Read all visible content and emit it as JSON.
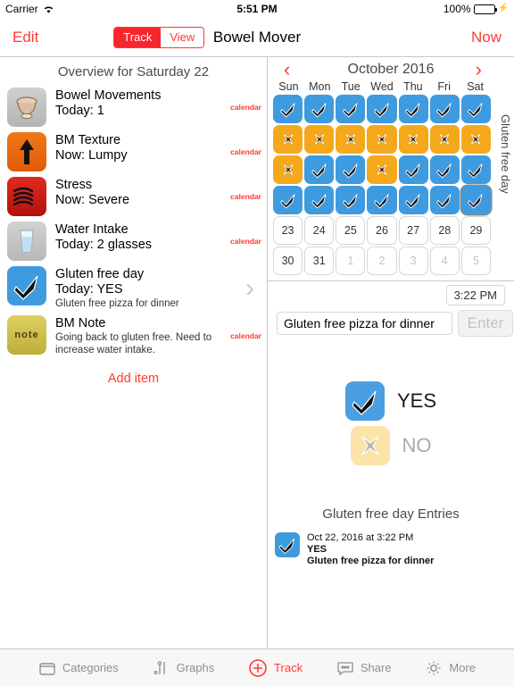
{
  "status_bar": {
    "carrier": "Carrier",
    "wifi_icon": "wifi-icon",
    "time": "5:51 PM",
    "battery_percent": "100%",
    "battery_icon": "battery-full-icon",
    "charging_icon": "lightning-bolt-icon"
  },
  "navbar": {
    "edit_label": "Edit",
    "segmented": {
      "track_label": "Track",
      "view_label": "View",
      "selected": "Track"
    },
    "title": "Bowel Mover",
    "now_label": "Now"
  },
  "left_panel": {
    "overview_title": "Overview for Saturday 22",
    "calendar_link_label": "calendar",
    "add_item_label": "Add item",
    "items": [
      {
        "icon": "toilet-icon",
        "title": "Bowel Movements",
        "subtitle": "Today: 1",
        "note": "",
        "accessory": "calendar"
      },
      {
        "icon": "up-arrow-icon",
        "title": "BM Texture",
        "subtitle": "Now: Lumpy",
        "note": "",
        "accessory": "calendar"
      },
      {
        "icon": "stress-waves-icon",
        "title": "Stress",
        "subtitle": "Now: Severe",
        "note": "",
        "accessory": "calendar"
      },
      {
        "icon": "water-glass-icon",
        "title": "Water Intake",
        "subtitle": "Today: 2 glasses",
        "note": "",
        "accessory": "calendar"
      },
      {
        "icon": "checkmark-icon",
        "title": "Gluten free day",
        "subtitle": "Today: YES",
        "note": "Gluten free pizza for dinner",
        "accessory": "chevron"
      },
      {
        "icon": "note-icon",
        "title": "BM Note",
        "subtitle": "",
        "note": "Going back to gluten free. Need to increase water intake.",
        "accessory": "calendar"
      }
    ]
  },
  "calendar": {
    "prev_icon": "chevron-left-icon",
    "next_icon": "chevron-right-icon",
    "month_label": "October 2016",
    "vertical_label": "Gluten free day",
    "day_headers": [
      "Sun",
      "Mon",
      "Tue",
      "Wed",
      "Thu",
      "Fri",
      "Sat"
    ],
    "yes_color": "#3e9be0",
    "no_color": "#f5a81c",
    "cells": [
      {
        "kind": "yes"
      },
      {
        "kind": "yes"
      },
      {
        "kind": "yes"
      },
      {
        "kind": "yes"
      },
      {
        "kind": "yes"
      },
      {
        "kind": "yes"
      },
      {
        "kind": "yes"
      },
      {
        "kind": "no"
      },
      {
        "kind": "no"
      },
      {
        "kind": "no"
      },
      {
        "kind": "no"
      },
      {
        "kind": "no"
      },
      {
        "kind": "no"
      },
      {
        "kind": "no"
      },
      {
        "kind": "no"
      },
      {
        "kind": "yes"
      },
      {
        "kind": "yes"
      },
      {
        "kind": "no"
      },
      {
        "kind": "yes"
      },
      {
        "kind": "yes"
      },
      {
        "kind": "yes"
      },
      {
        "kind": "yes"
      },
      {
        "kind": "yes"
      },
      {
        "kind": "yes"
      },
      {
        "kind": "yes"
      },
      {
        "kind": "yes"
      },
      {
        "kind": "yes"
      },
      {
        "kind": "yes",
        "selected": true
      },
      {
        "kind": "num",
        "label": "23"
      },
      {
        "kind": "num",
        "label": "24"
      },
      {
        "kind": "num",
        "label": "25"
      },
      {
        "kind": "num",
        "label": "26"
      },
      {
        "kind": "num",
        "label": "27"
      },
      {
        "kind": "num",
        "label": "28"
      },
      {
        "kind": "num",
        "label": "29"
      },
      {
        "kind": "num",
        "label": "30"
      },
      {
        "kind": "num",
        "label": "31"
      },
      {
        "kind": "num",
        "label": "1",
        "dim": true
      },
      {
        "kind": "num",
        "label": "2",
        "dim": true
      },
      {
        "kind": "num",
        "label": "3",
        "dim": true
      },
      {
        "kind": "num",
        "label": "4",
        "dim": true
      },
      {
        "kind": "num",
        "label": "5",
        "dim": true
      }
    ]
  },
  "entry_bar": {
    "time_label": "3:22 PM",
    "input_value": "Gluten free pizza for dinner",
    "input_placeholder": "",
    "enter_label": "Enter"
  },
  "detail": {
    "yes_label": "YES",
    "no_label": "NO",
    "selected": "YES",
    "entries_title": "Gluten free day Entries",
    "entries": [
      {
        "icon": "checkmark-icon",
        "timestamp": "Oct 22, 2016 at 3:22 PM",
        "value": "YES",
        "note": "Gluten free pizza for dinner"
      }
    ]
  },
  "tabbar": {
    "items": [
      {
        "label": "Categories",
        "icon": "categories-icon",
        "active": false
      },
      {
        "label": "Graphs",
        "icon": "graphs-icon",
        "active": false
      },
      {
        "label": "Track",
        "icon": "plus-circle-icon",
        "active": true
      },
      {
        "label": "Share",
        "icon": "share-icon",
        "active": false
      },
      {
        "label": "More",
        "icon": "gear-icon",
        "active": false
      }
    ]
  }
}
